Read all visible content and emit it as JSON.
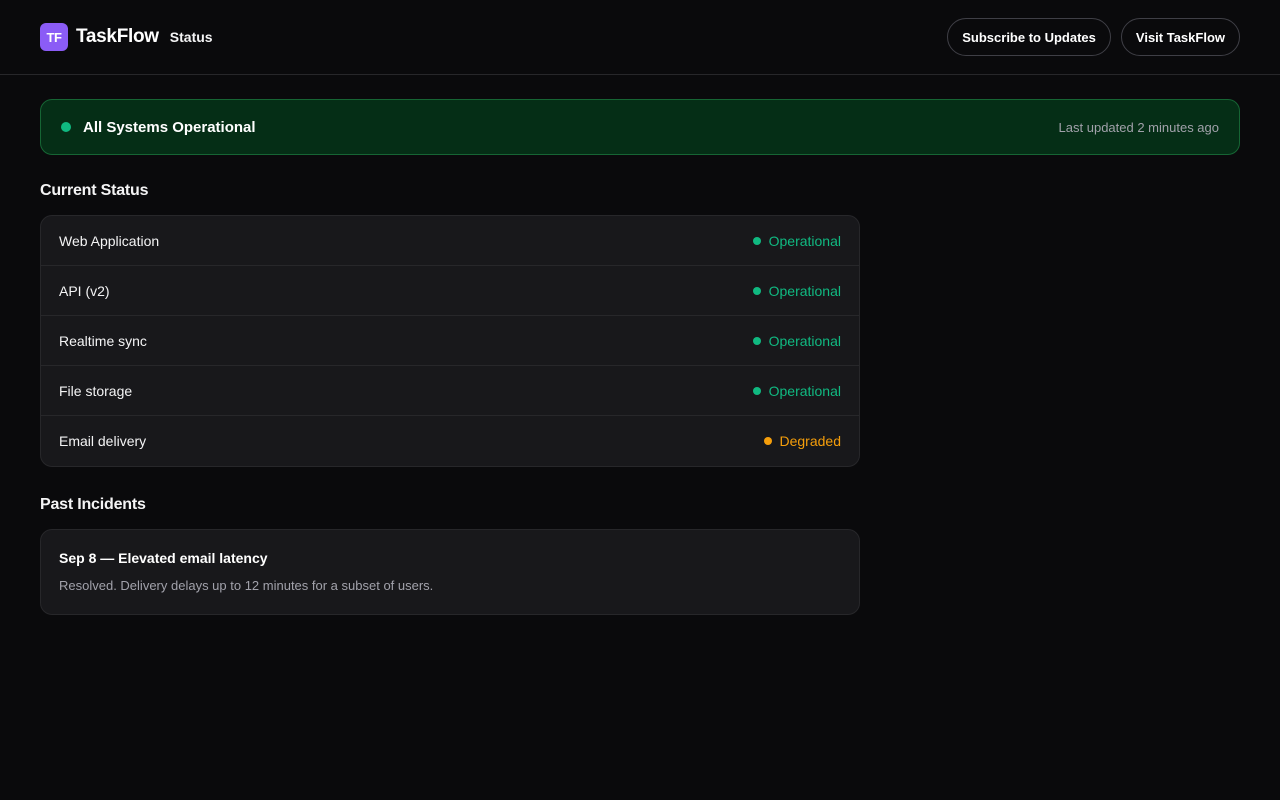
{
  "header": {
    "logo_text": "TF",
    "brand_name": "TaskFlow",
    "brand_sub": "Status",
    "subscribe_label": "Subscribe to Updates",
    "visit_label": "Visit TaskFlow"
  },
  "banner": {
    "title": "All Systems Operational",
    "updated": "Last updated 2 minutes ago",
    "color": "#10b981"
  },
  "current_status": {
    "title": "Current Status",
    "services": [
      {
        "name": "Web Application",
        "status": "Operational",
        "color": "#10b981"
      },
      {
        "name": "API (v2)",
        "status": "Operational",
        "color": "#10b981"
      },
      {
        "name": "Realtime sync",
        "status": "Operational",
        "color": "#10b981"
      },
      {
        "name": "File storage",
        "status": "Operational",
        "color": "#10b981"
      },
      {
        "name": "Email delivery",
        "status": "Degraded",
        "color": "#f59e0b"
      }
    ]
  },
  "past_incidents": {
    "title": "Past Incidents",
    "items": [
      {
        "title": "Sep 8 — Elevated email latency",
        "description": "Resolved. Delivery delays up to 12 minutes for a subset of users."
      }
    ]
  }
}
